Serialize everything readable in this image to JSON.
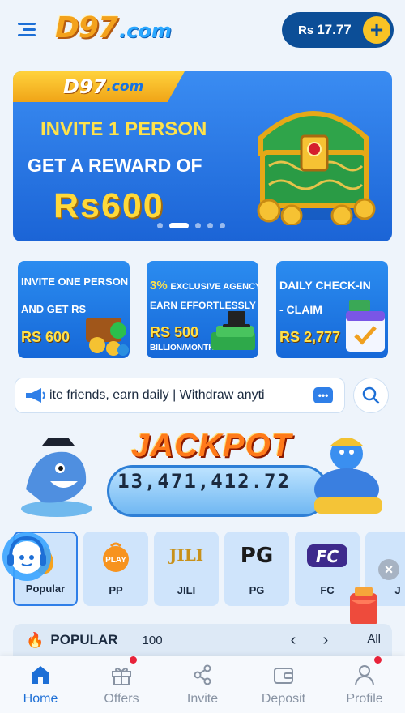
{
  "header": {
    "logo_main": "D97",
    "logo_suffix": ".com",
    "balance_currency": "Rs",
    "balance_amount": "17.77",
    "add_label": "+"
  },
  "banner": {
    "tag_main": "D97",
    "tag_suffix": ".com",
    "line1": "INVITE 1 PERSON",
    "line2": "GET A REWARD OF",
    "line3": "Rs600",
    "slide_count": 5,
    "active_slide": 2
  },
  "promos": [
    {
      "line1": "INVITE ONE PERSON",
      "line2": "AND GET RS",
      "amount": "RS 600"
    },
    {
      "line1_highlight": "3%",
      "line1": "EXCLUSIVE AGENCY",
      "line2": "EARN EFFORTLESSLY",
      "amount": "RS 500",
      "line3": "BILLION/MONTH"
    },
    {
      "line1": "DAILY CHECK-IN",
      "line2": "- CLAIM",
      "amount": "RS 2,777"
    }
  ],
  "marquee": {
    "text": "ite friends, earn daily | Withdraw anyti"
  },
  "jackpot": {
    "title": "JACKPOT",
    "amount": "13,471,412.72"
  },
  "categories": [
    {
      "label": "Popular",
      "icon": "popular-icon",
      "active": true
    },
    {
      "label": "PP",
      "icon": "pp-icon",
      "logo_text": "PLAY"
    },
    {
      "label": "JILI",
      "icon": "jili-icon",
      "logo_text": "JILI"
    },
    {
      "label": "PG",
      "icon": "pg-icon",
      "logo_text": "PG"
    },
    {
      "label": "FC",
      "icon": "fc-icon",
      "logo_text": "FC"
    },
    {
      "label": "J",
      "icon": "partial-icon"
    }
  ],
  "popular_section": {
    "title": "POPULAR",
    "count": "100",
    "prev_label": "‹",
    "next_label": "›",
    "all_label": "All"
  },
  "bottom_nav": [
    {
      "label": "Home",
      "icon": "home-icon",
      "active": true,
      "badge": false
    },
    {
      "label": "Offers",
      "icon": "gift-icon",
      "active": false,
      "badge": true
    },
    {
      "label": "Invite",
      "icon": "share-icon",
      "active": false,
      "badge": false
    },
    {
      "label": "Deposit",
      "icon": "wallet-icon",
      "active": false,
      "badge": false
    },
    {
      "label": "Profile",
      "icon": "profile-icon",
      "active": false,
      "badge": true
    }
  ],
  "colors": {
    "accent": "#1d6fd6",
    "balance_bg": "#0c4e97",
    "gold": "#f8c325",
    "badge_red": "#e8233a"
  }
}
